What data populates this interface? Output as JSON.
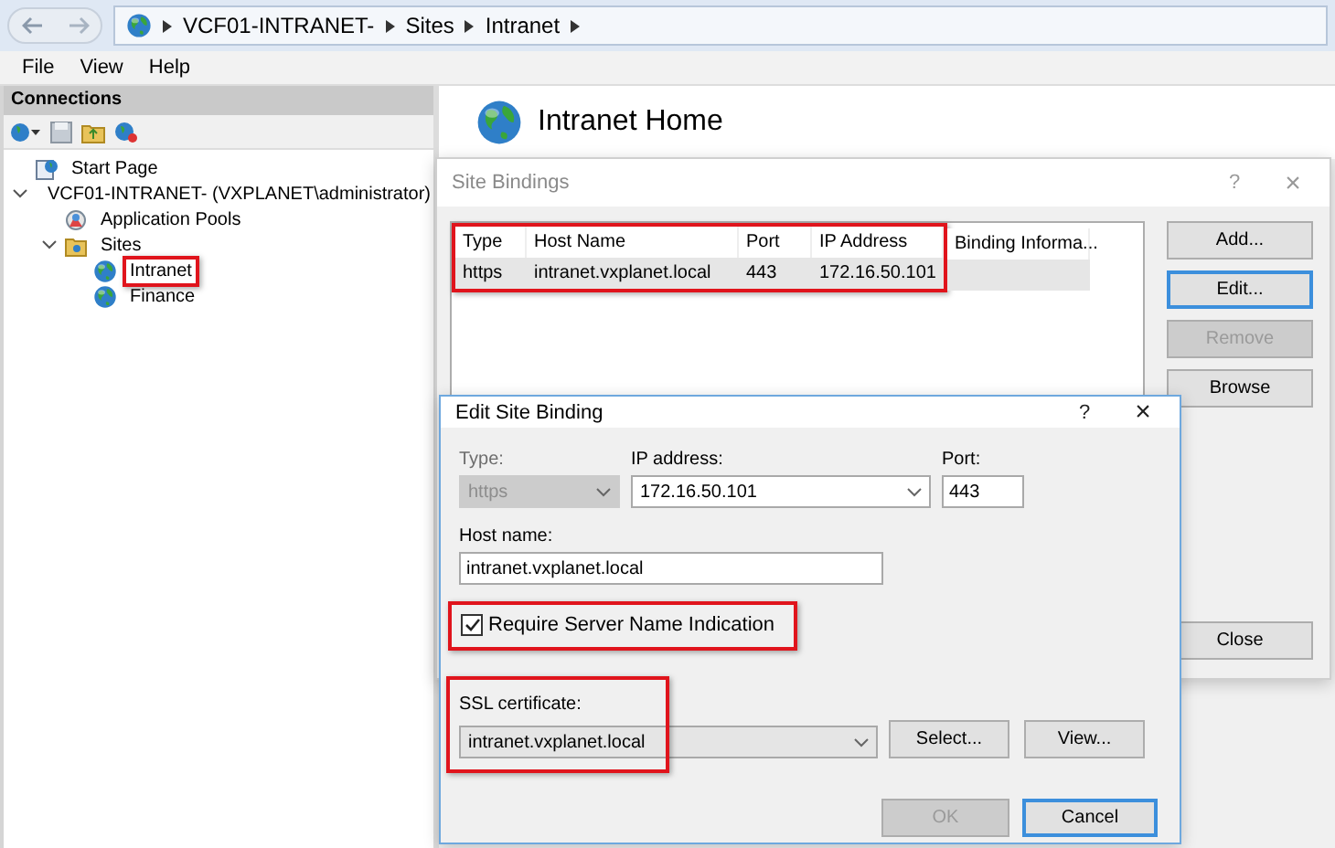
{
  "address_bar": {
    "crumbs": [
      "VCF01-INTRANET-",
      "Sites",
      "Intranet"
    ]
  },
  "menu": [
    "File",
    "View",
    "Help"
  ],
  "connections": {
    "title": "Connections",
    "tree": [
      {
        "label": "Start Page",
        "kind": "page",
        "highlighted": false
      },
      {
        "label": "VCF01-INTRANET- (VXPLANET\\administrator)",
        "kind": "server",
        "expanded": true,
        "highlighted": false,
        "children": [
          {
            "label": "Application Pools",
            "kind": "pools",
            "highlighted": false
          },
          {
            "label": "Sites",
            "kind": "folder",
            "expanded": true,
            "highlighted": false,
            "children": [
              {
                "label": "Intranet",
                "kind": "site",
                "highlighted": true
              },
              {
                "label": "Finance",
                "kind": "site",
                "highlighted": false
              }
            ]
          }
        ]
      }
    ]
  },
  "content": {
    "title": "Intranet Home"
  },
  "site_bindings": {
    "title": "Site Bindings",
    "help": "?",
    "close": "×",
    "highlighted": true,
    "columns": [
      "Type",
      "Host Name",
      "Port",
      "IP Address",
      "Binding Informa..."
    ],
    "rows": [
      {
        "cells": [
          "https",
          "intranet.vxplanet.local",
          "443",
          "172.16.50.101"
        ],
        "selected": true
      }
    ],
    "buttons": [
      {
        "label": "Add...",
        "disabled": false,
        "focused": false
      },
      {
        "label": "Edit...",
        "disabled": false,
        "focused": true
      },
      {
        "label": "Remove",
        "disabled": true,
        "focused": false
      },
      {
        "label": "Browse",
        "disabled": false,
        "focused": false
      }
    ],
    "close_button": "Close"
  },
  "edit_binding": {
    "title": "Edit Site Binding",
    "help": "?",
    "close": "×",
    "type": {
      "label": "Type:",
      "value": "https",
      "disabled": true
    },
    "ip_address": {
      "label": "IP address:",
      "value": "172.16.50.101"
    },
    "port": {
      "label": "Port:",
      "value": "443"
    },
    "host_name": {
      "label": "Host name:",
      "value": "intranet.vxplanet.local"
    },
    "sni": {
      "label": "Require Server Name Indication",
      "checked": true,
      "highlighted": true
    },
    "ssl_certificate": {
      "label": "SSL certificate:",
      "value": "intranet.vxplanet.local",
      "highlighted": true
    },
    "cert_buttons": [
      "Select...",
      "View..."
    ],
    "ok": {
      "label": "OK",
      "disabled": true
    },
    "cancel": {
      "label": "Cancel",
      "focused": true
    }
  }
}
